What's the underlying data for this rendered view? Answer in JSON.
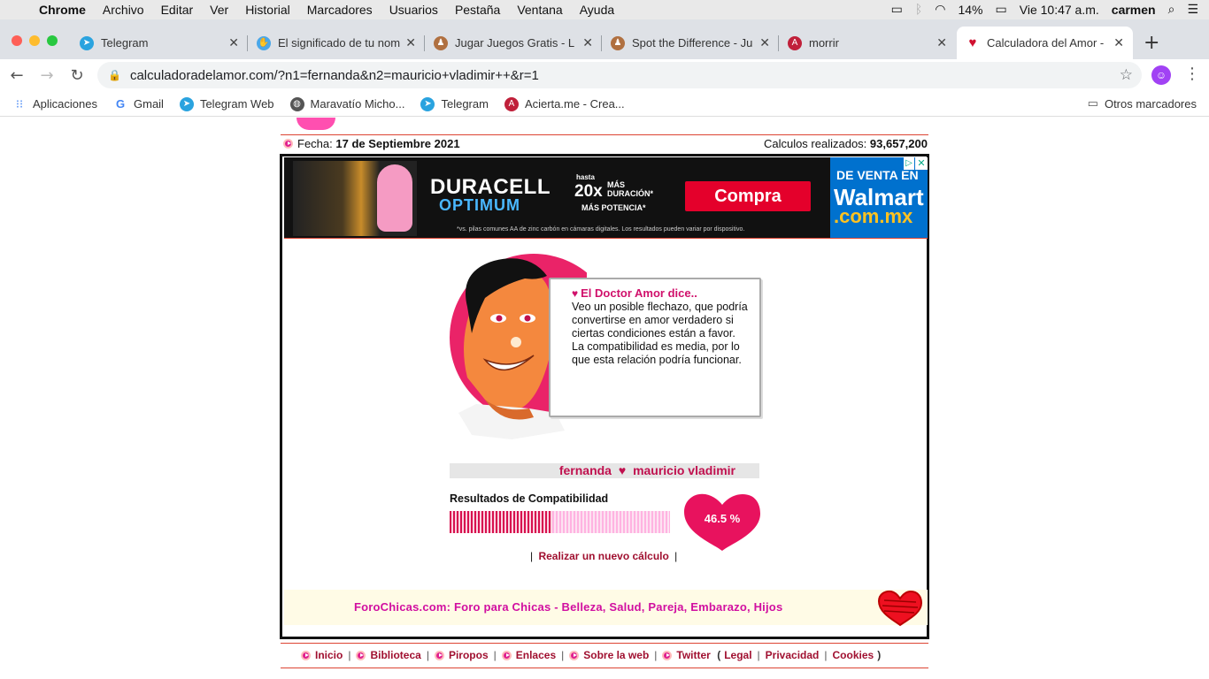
{
  "menubar": {
    "app": "Chrome",
    "items": [
      "Archivo",
      "Editar",
      "Ver",
      "Historial",
      "Marcadores",
      "Usuarios",
      "Pestaña",
      "Ventana",
      "Ayuda"
    ],
    "battery": "14%",
    "clock": "Vie 10:47 a.m.",
    "user": "carmen"
  },
  "tabs": [
    {
      "label": "Telegram",
      "favicon": "telegram-icon",
      "color": "#2aa3df"
    },
    {
      "label": "El significado de tu nom",
      "favicon": "hand-icon",
      "color": "#4aa7e8"
    },
    {
      "label": "Jugar Juegos Gratis - L",
      "favicon": "game-icon",
      "color": "#b07040"
    },
    {
      "label": "Spot the Difference - Ju",
      "favicon": "game-icon",
      "color": "#b07040"
    },
    {
      "label": "morrir",
      "favicon": "acierta-icon",
      "color": "#c0203a"
    },
    {
      "label": "Calculadora del Amor -",
      "favicon": "heart-icon",
      "color": "#d01030"
    }
  ],
  "address": {
    "url": "calculadoradelamor.com/?n1=fernanda&n2=mauricio+vladimir++&r=1"
  },
  "bookmarks": {
    "items": [
      {
        "label": "Aplicaciones",
        "icon": "apps-grid-icon"
      },
      {
        "label": "Gmail",
        "icon": "google-icon"
      },
      {
        "label": "Telegram Web",
        "icon": "telegram-icon"
      },
      {
        "label": "Maravatío Micho...",
        "icon": "globe-icon"
      },
      {
        "label": "Telegram",
        "icon": "telegram-icon"
      },
      {
        "label": "Acierta.me - Crea...",
        "icon": "acierta-icon"
      }
    ],
    "other": "Otros marcadores"
  },
  "page": {
    "date_label": "Fecha:",
    "date_value": "17 de Septiembre 2021",
    "count_label": "Calculos realizados:",
    "count_value": "93,657,200",
    "ad": {
      "brand": "DURACELL",
      "subbrand": "OPTIMUM",
      "promo_small": "hasta",
      "promo_big": "20x",
      "promo_mas": "MÁS DURACIÓN*",
      "promo_pot": "MÁS POTENCIA*",
      "button": "Compra",
      "disclaimer": "*vs. pilas comunes AA de zinc carbón en cámaras digitales. Los resultados pueden variar por dispositivo.",
      "side_1": "DE VENTA EN",
      "side_2": "Walmart",
      "side_3": ".com.mx"
    },
    "doctor_title": "El Doctor Amor dice..",
    "doctor_text": "Veo un posible flechazo, que podría convertirse en amor verdadero si ciertas condiciones están a favor. La compatibilidad es media, por lo que esta relación podría funcionar.",
    "name1": "fernanda",
    "name2": "mauricio vladimir",
    "results_label": "Resultados de Compatibilidad",
    "percent": 46.5,
    "percent_text": "46.5 %",
    "recalc": "Realizar un nuevo cálculo",
    "foro": "ForoChicas.com: Foro para Chicas - Belleza, Salud, Pareja, Embarazo, Hijos",
    "footer_links": [
      "Inicio",
      "Biblioteca",
      "Piropos",
      "Enlaces",
      "Sobre la web",
      "Twitter"
    ],
    "footer_legal": [
      "Legal",
      "Privacidad",
      "Cookies"
    ],
    "accent": "#d0106b"
  }
}
